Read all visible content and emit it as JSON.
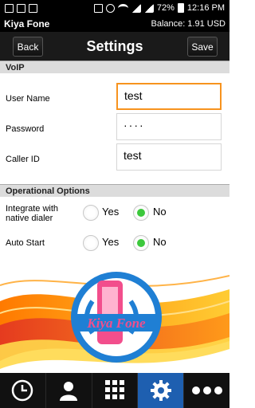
{
  "status_bar": {
    "battery_percent": "72%",
    "time": "12:16 PM"
  },
  "app_bar": {
    "app_name": "Kiya Fone",
    "balance_label": "Balance:",
    "balance_value": "1.91 USD"
  },
  "toolbar": {
    "back_label": "Back",
    "title": "Settings",
    "save_label": "Save"
  },
  "voip": {
    "section_title": "VoIP",
    "username_label": "User Name",
    "username_value": "test",
    "password_label": "Password",
    "password_value": "····",
    "callerid_label": "Caller ID",
    "callerid_value": "test"
  },
  "operational": {
    "section_title": "Operational Options",
    "native_dialer_label_line1": "Integrate with",
    "native_dialer_label_line2": "native dialer",
    "native_dialer_selected": "No",
    "auto_start_label": "Auto Start",
    "auto_start_selected": "No",
    "yes_label": "Yes",
    "no_label": "No"
  },
  "banner": {
    "logo_text": "Kiya Fone"
  },
  "bottom_nav": {
    "items": [
      "history-icon",
      "contacts-icon",
      "dialpad-icon",
      "settings-icon",
      "more-icon"
    ],
    "active_index": 3
  },
  "colors": {
    "accent": "#f7931e",
    "radio_checked": "#3cc83c",
    "nav_active": "#1e5fb0"
  }
}
